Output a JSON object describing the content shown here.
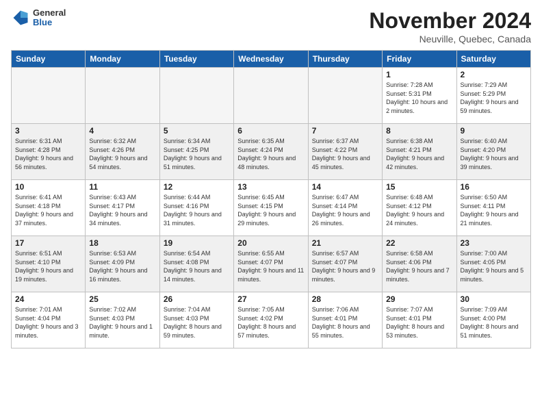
{
  "header": {
    "logo": {
      "general": "General",
      "blue": "Blue"
    },
    "title": "November 2024",
    "location": "Neuville, Quebec, Canada"
  },
  "calendar": {
    "days_of_week": [
      "Sunday",
      "Monday",
      "Tuesday",
      "Wednesday",
      "Thursday",
      "Friday",
      "Saturday"
    ],
    "weeks": [
      [
        {
          "day": "",
          "empty": true
        },
        {
          "day": "",
          "empty": true
        },
        {
          "day": "",
          "empty": true
        },
        {
          "day": "",
          "empty": true
        },
        {
          "day": "",
          "empty": true
        },
        {
          "day": "1",
          "sunrise": "7:28 AM",
          "sunset": "5:31 PM",
          "daylight": "10 hours and 2 minutes."
        },
        {
          "day": "2",
          "sunrise": "7:29 AM",
          "sunset": "5:29 PM",
          "daylight": "9 hours and 59 minutes."
        }
      ],
      [
        {
          "day": "3",
          "sunrise": "6:31 AM",
          "sunset": "4:28 PM",
          "daylight": "9 hours and 56 minutes."
        },
        {
          "day": "4",
          "sunrise": "6:32 AM",
          "sunset": "4:26 PM",
          "daylight": "9 hours and 54 minutes."
        },
        {
          "day": "5",
          "sunrise": "6:34 AM",
          "sunset": "4:25 PM",
          "daylight": "9 hours and 51 minutes."
        },
        {
          "day": "6",
          "sunrise": "6:35 AM",
          "sunset": "4:24 PM",
          "daylight": "9 hours and 48 minutes."
        },
        {
          "day": "7",
          "sunrise": "6:37 AM",
          "sunset": "4:22 PM",
          "daylight": "9 hours and 45 minutes."
        },
        {
          "day": "8",
          "sunrise": "6:38 AM",
          "sunset": "4:21 PM",
          "daylight": "9 hours and 42 minutes."
        },
        {
          "day": "9",
          "sunrise": "6:40 AM",
          "sunset": "4:20 PM",
          "daylight": "9 hours and 39 minutes."
        }
      ],
      [
        {
          "day": "10",
          "sunrise": "6:41 AM",
          "sunset": "4:18 PM",
          "daylight": "9 hours and 37 minutes."
        },
        {
          "day": "11",
          "sunrise": "6:43 AM",
          "sunset": "4:17 PM",
          "daylight": "9 hours and 34 minutes."
        },
        {
          "day": "12",
          "sunrise": "6:44 AM",
          "sunset": "4:16 PM",
          "daylight": "9 hours and 31 minutes."
        },
        {
          "day": "13",
          "sunrise": "6:45 AM",
          "sunset": "4:15 PM",
          "daylight": "9 hours and 29 minutes."
        },
        {
          "day": "14",
          "sunrise": "6:47 AM",
          "sunset": "4:14 PM",
          "daylight": "9 hours and 26 minutes."
        },
        {
          "day": "15",
          "sunrise": "6:48 AM",
          "sunset": "4:12 PM",
          "daylight": "9 hours and 24 minutes."
        },
        {
          "day": "16",
          "sunrise": "6:50 AM",
          "sunset": "4:11 PM",
          "daylight": "9 hours and 21 minutes."
        }
      ],
      [
        {
          "day": "17",
          "sunrise": "6:51 AM",
          "sunset": "4:10 PM",
          "daylight": "9 hours and 19 minutes."
        },
        {
          "day": "18",
          "sunrise": "6:53 AM",
          "sunset": "4:09 PM",
          "daylight": "9 hours and 16 minutes."
        },
        {
          "day": "19",
          "sunrise": "6:54 AM",
          "sunset": "4:08 PM",
          "daylight": "9 hours and 14 minutes."
        },
        {
          "day": "20",
          "sunrise": "6:55 AM",
          "sunset": "4:07 PM",
          "daylight": "9 hours and 11 minutes."
        },
        {
          "day": "21",
          "sunrise": "6:57 AM",
          "sunset": "4:07 PM",
          "daylight": "9 hours and 9 minutes."
        },
        {
          "day": "22",
          "sunrise": "6:58 AM",
          "sunset": "4:06 PM",
          "daylight": "9 hours and 7 minutes."
        },
        {
          "day": "23",
          "sunrise": "7:00 AM",
          "sunset": "4:05 PM",
          "daylight": "9 hours and 5 minutes."
        }
      ],
      [
        {
          "day": "24",
          "sunrise": "7:01 AM",
          "sunset": "4:04 PM",
          "daylight": "9 hours and 3 minutes."
        },
        {
          "day": "25",
          "sunrise": "7:02 AM",
          "sunset": "4:03 PM",
          "daylight": "9 hours and 1 minute."
        },
        {
          "day": "26",
          "sunrise": "7:04 AM",
          "sunset": "4:03 PM",
          "daylight": "8 hours and 59 minutes."
        },
        {
          "day": "27",
          "sunrise": "7:05 AM",
          "sunset": "4:02 PM",
          "daylight": "8 hours and 57 minutes."
        },
        {
          "day": "28",
          "sunrise": "7:06 AM",
          "sunset": "4:01 PM",
          "daylight": "8 hours and 55 minutes."
        },
        {
          "day": "29",
          "sunrise": "7:07 AM",
          "sunset": "4:01 PM",
          "daylight": "8 hours and 53 minutes."
        },
        {
          "day": "30",
          "sunrise": "7:09 AM",
          "sunset": "4:00 PM",
          "daylight": "8 hours and 51 minutes."
        }
      ]
    ]
  }
}
